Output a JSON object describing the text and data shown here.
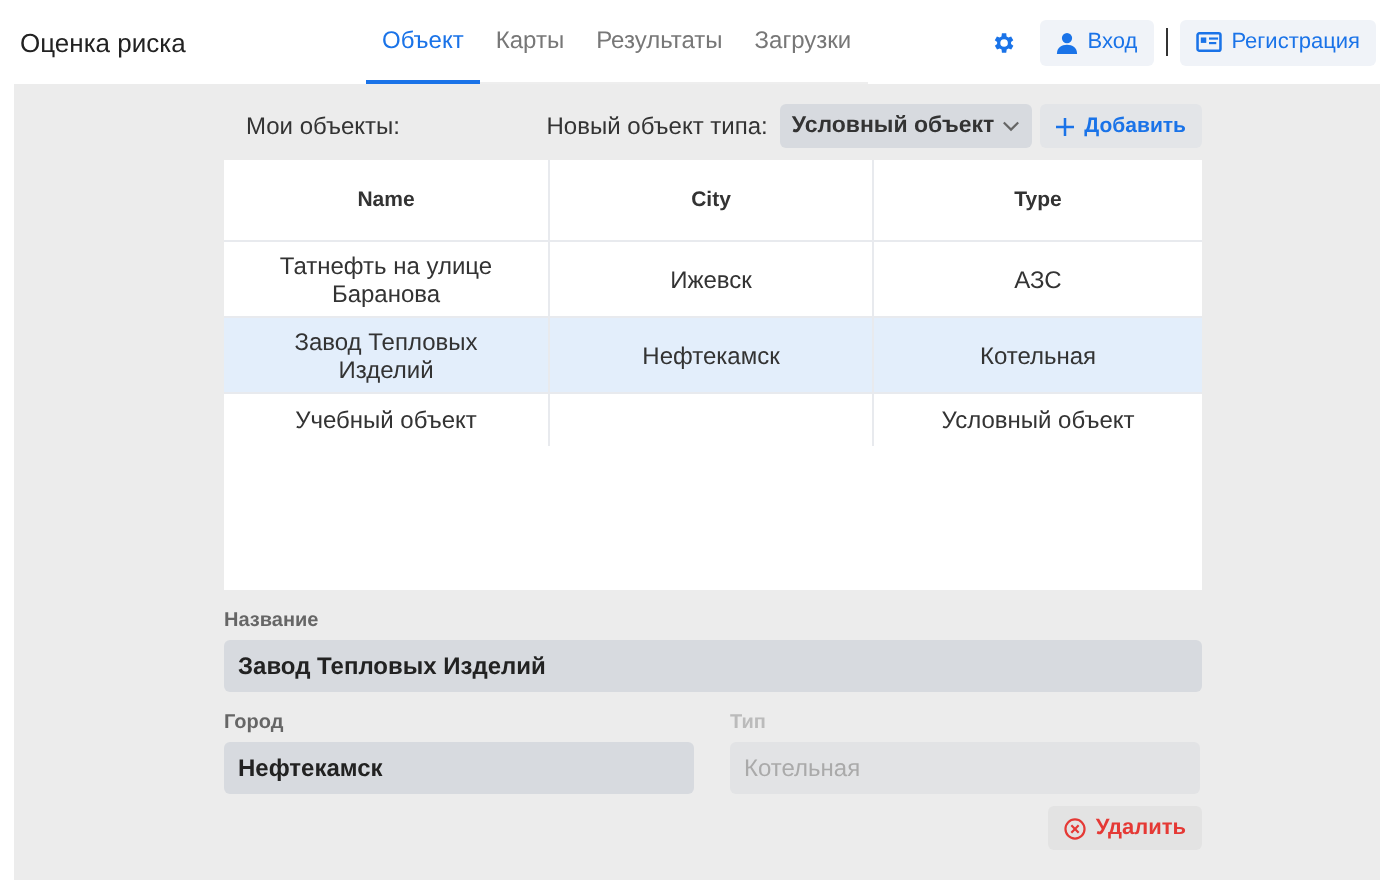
{
  "app_title": "Оценка риска",
  "tabs": [
    {
      "label": "Объект",
      "selected": true
    },
    {
      "label": "Карты",
      "selected": false
    },
    {
      "label": "Результаты",
      "selected": false
    },
    {
      "label": "Загрузки",
      "selected": false
    }
  ],
  "login": "Вход",
  "register": "Регистрация",
  "toolbar": {
    "label": "Мои объекты:",
    "type_label": "Новый объект типа:",
    "type_value": "Условный объект",
    "add": "Добавить"
  },
  "table": {
    "columns": [
      "Name",
      "City",
      "Type"
    ],
    "rows": [
      {
        "cells": [
          "Татнефть на улице Баранова",
          "Ижевск",
          "АЗС"
        ],
        "selected": false
      },
      {
        "cells": [
          "Завод Тепловых Изделий",
          "Нефтекамск",
          "Котельная"
        ],
        "selected": true
      },
      {
        "cells": [
          "Учебный объект",
          "",
          "Условный объект"
        ],
        "selected": false
      }
    ]
  },
  "fields": [
    {
      "label": "Название",
      "value": "Завод Тепловых Изделий",
      "disabled": false,
      "wide": true
    },
    {
      "label": "Город",
      "value": "Нефтекамск",
      "disabled": false,
      "wide": false
    },
    {
      "label": "Тип",
      "value": "Котельная",
      "disabled": true,
      "wide": false
    }
  ],
  "delete": "Удалить"
}
